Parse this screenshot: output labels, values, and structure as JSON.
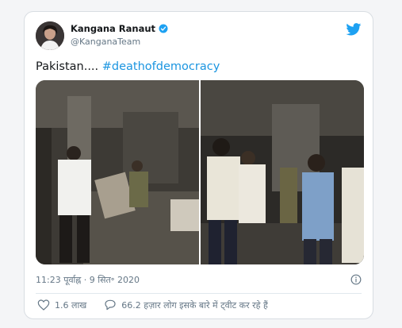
{
  "tweet": {
    "author_name": "Kangana Ranaut",
    "author_handle": "@KanganaTeam",
    "text_plain": "Pakistan.... ",
    "text_hashtag": "#deathofdemocracy",
    "timestamp": "11:23 पूर्वाह्न · 9 सित॰ 2020",
    "likes": "1.6 लाख",
    "replies": "66.2 हज़ार लोग इसके बारे में ट्वीट कर रहे हैं"
  },
  "icons": {
    "verified": "verified-badge-icon",
    "logo": "twitter-bird-icon",
    "info": "info-icon",
    "like": "heart-icon",
    "reply": "speech-bubble-icon"
  },
  "colors": {
    "link": "#1b95e0",
    "twitter_blue": "#1da1f2",
    "text": "#14171a",
    "muted": "#657786"
  }
}
